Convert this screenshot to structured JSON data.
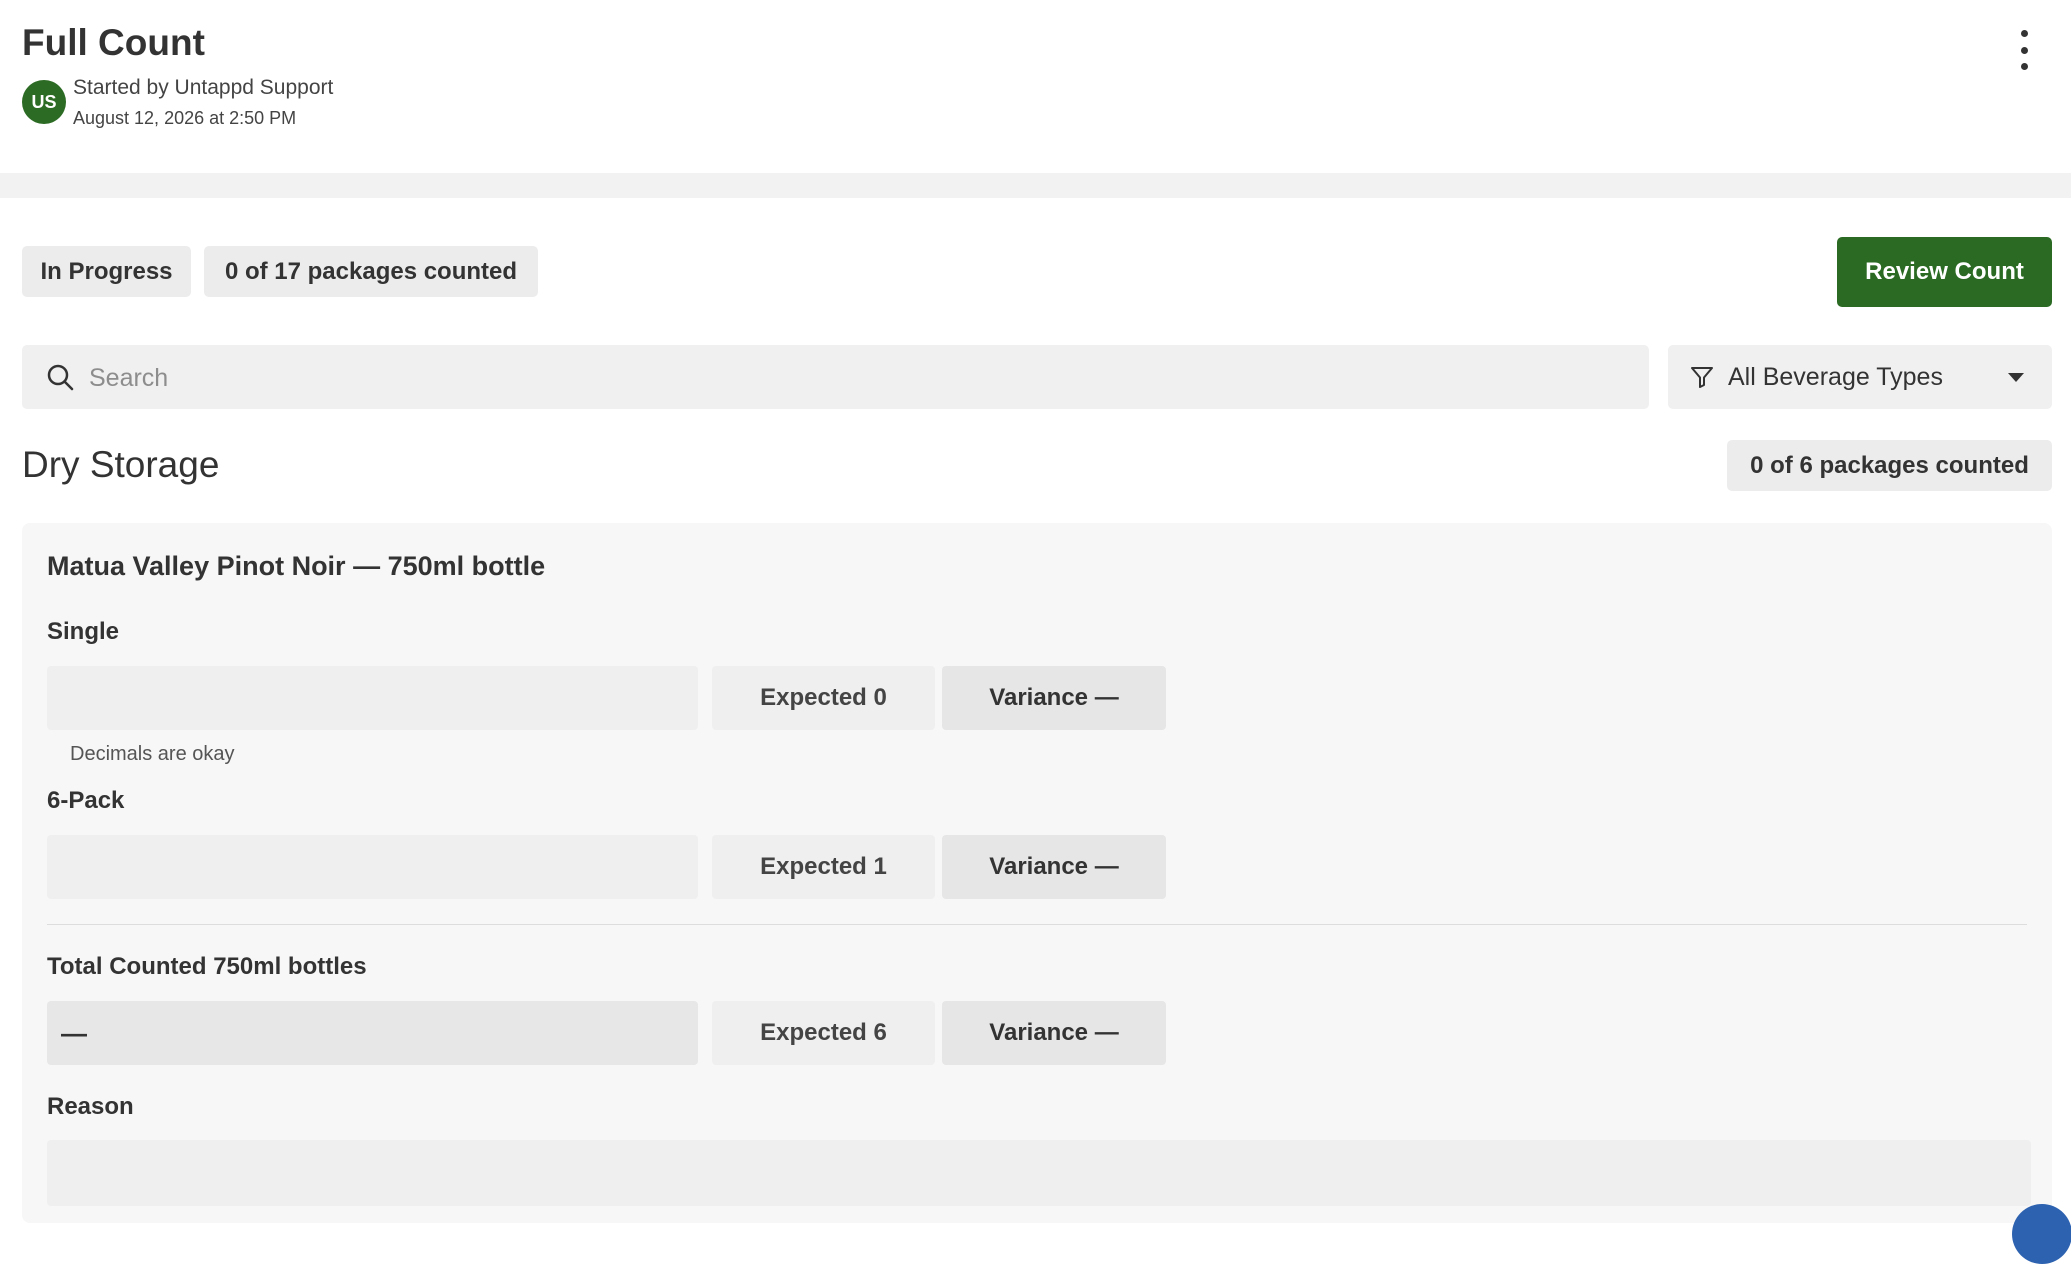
{
  "header": {
    "title": "Full Count",
    "avatar_initials": "US",
    "started_by": "Started by Untappd Support",
    "started_at": "August 12, 2026 at 2:50 PM",
    "more_icon": "kebab-vertical-icon"
  },
  "status": {
    "state_label": "In Progress",
    "progress_label": "0 of 17 packages counted",
    "counted": 0,
    "total": 17
  },
  "actions": {
    "review_label": "Review Count"
  },
  "search": {
    "placeholder": "Search",
    "value": "",
    "icon": "search-icon"
  },
  "filter": {
    "selected": "All Beverage Types",
    "icon": "filter-icon"
  },
  "section": {
    "title": "Dry Storage",
    "progress_label": "0 of 6 packages counted"
  },
  "item": {
    "title": "Matua Valley Pinot Noir — 750ml bottle",
    "rows": [
      {
        "label": "Single",
        "value": "",
        "expected": "Expected 0",
        "variance": "Variance —",
        "hint": "Decimals are okay"
      },
      {
        "label": "6-Pack",
        "value": "",
        "expected": "Expected 1",
        "variance": "Variance —"
      }
    ],
    "total": {
      "label": "Total Counted 750ml bottles",
      "value": "—",
      "expected": "Expected 6",
      "variance": "Variance —"
    },
    "reason_label": "Reason",
    "reason_value": ""
  },
  "colors": {
    "brand_green": "#2a6a22",
    "pill_bg": "#ececec",
    "card_bg": "#f7f7f7"
  }
}
